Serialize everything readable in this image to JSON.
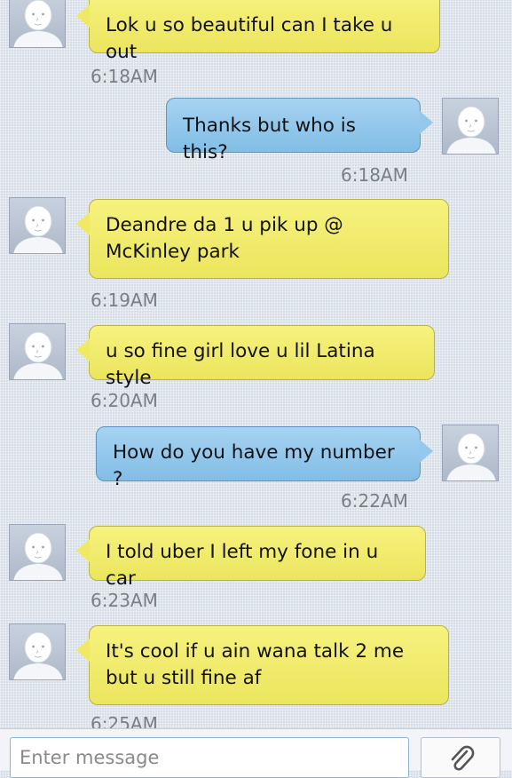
{
  "messages": [
    {
      "dir": "in",
      "text": "Lok u so beautiful can I take u out",
      "time": "6:18AM",
      "icon": "contact-avatar-icon"
    },
    {
      "dir": "out",
      "text": "Thanks but who is this?",
      "time": "6:18AM",
      "icon": "contact-avatar-icon"
    },
    {
      "dir": "in",
      "text": "Deandre da 1 u pik up @ McKinley park",
      "time": "6:19AM",
      "icon": "contact-avatar-icon"
    },
    {
      "dir": "in",
      "text": "u so fine girl love u lil Latina style",
      "time": "6:20AM",
      "icon": "contact-avatar-icon"
    },
    {
      "dir": "out",
      "text": "How do you have my number ?",
      "time": "6:22AM",
      "icon": "contact-avatar-icon"
    },
    {
      "dir": "in",
      "text": "I told uber I left my fone in u car",
      "time": "6:23AM",
      "icon": "contact-avatar-icon"
    },
    {
      "dir": "in",
      "text": "It's cool if u ain wana talk 2 me but u still fine af",
      "time": "6:25AM",
      "icon": "contact-avatar-icon"
    }
  ],
  "composer": {
    "placeholder": "Enter message",
    "attach_icon": "paperclip-icon"
  },
  "colors": {
    "incoming_bubble": "#efe964",
    "outgoing_bubble": "#94c8ec",
    "timestamp": "#7a7f86"
  }
}
